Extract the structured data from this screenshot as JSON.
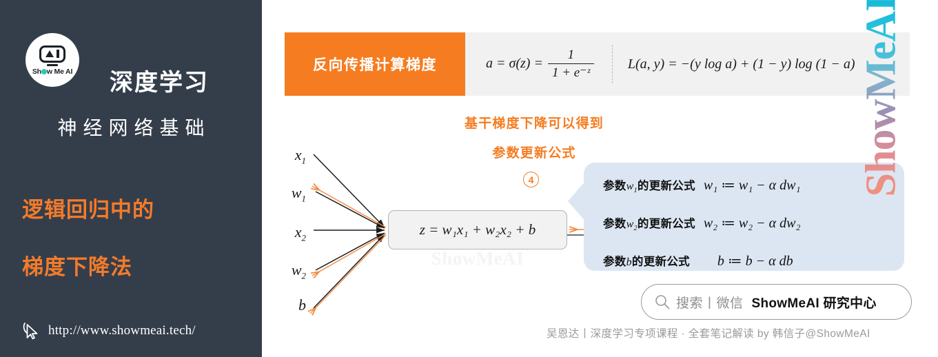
{
  "sidebar": {
    "logo": {
      "icon": "showmeai-monitor-logo",
      "text_before": "Sh",
      "text_after": "w Me AI"
    },
    "title_line1": "深度学习",
    "title_line2": "神经网络基础",
    "subtitle_line1": "逻辑回归中的",
    "subtitle_line2": "梯度下降法",
    "url": "http://www.showmeai.tech/",
    "cursor_icon": "cursor-pointer-icon",
    "bg_color": "#343E4B",
    "accent_color": "#F47B2A"
  },
  "banner": {
    "label": "反向传播计算梯度",
    "bg_color": "#F57C20",
    "formula_sigmoid": {
      "lhs": "a = σ(z) = ",
      "numerator": "1",
      "denominator": "1 + e⁻ᶻ"
    },
    "formula_loss": "L(a, y) = −(y log a) + (1 − y) log (1 − a)"
  },
  "mid": {
    "line1": "基干梯度下降可以得到",
    "line2": "参数更新公式",
    "step_number": "4"
  },
  "diagram": {
    "inputs": [
      {
        "label": "x",
        "sub": "1"
      },
      {
        "label": "w",
        "sub": "1"
      },
      {
        "label": "x",
        "sub": "2"
      },
      {
        "label": "w",
        "sub": "2"
      },
      {
        "label": "b",
        "sub": ""
      }
    ],
    "node_formula": "z = w₁x₁ + w₂x₂ + b",
    "watermark": "ShowMeAI",
    "forward_arrow_color": "#1b1b1b",
    "backward_arrow_color": "#F58A43"
  },
  "callout": {
    "bg_color": "#DCE6F3",
    "rows": [
      {
        "label_pre": "参数",
        "var": "w",
        "var_sub": "1",
        "label_post": "的更新公式",
        "equation": "w₁ ≔ w₁ − α dw₁"
      },
      {
        "label_pre": "参数",
        "var": "w",
        "var_sub": "2",
        "label_post": "的更新公式",
        "equation": "w₂ ≔ w₂ − α dw₂"
      },
      {
        "label_pre": "参数",
        "var": "b",
        "var_sub": "",
        "label_post": "的更新公式",
        "equation": "b ≔ b − α db"
      }
    ]
  },
  "searchbar": {
    "icon": "search-icon",
    "placeholder": "搜索丨微信",
    "brand": "ShowMeAI 研究中心"
  },
  "footer": {
    "text": "吴恩达丨深度学习专项课程 · 全套笔记解读  by 韩信子@ShowMeAI"
  },
  "watermark_right": "ShowMeAI"
}
